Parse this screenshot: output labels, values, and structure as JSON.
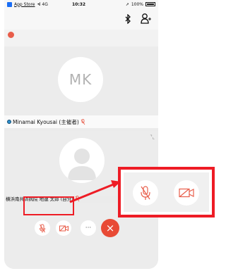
{
  "statusbar": {
    "app": "App Store",
    "network": "4G",
    "time": "10:32",
    "battery": "100%"
  },
  "participants": [
    {
      "initials": "MK",
      "name": "Minamai Kyousai (主催者)"
    },
    {
      "name": "横浜南共済病院 地連 太郎 (自分)"
    }
  ],
  "controls": {
    "mute": "mic-off",
    "video": "video-off",
    "more": "···",
    "end": "×"
  },
  "colors": {
    "accent_red": "#ee1c25",
    "end_button": "#e84a35",
    "icon_red": "#e85d4a"
  }
}
